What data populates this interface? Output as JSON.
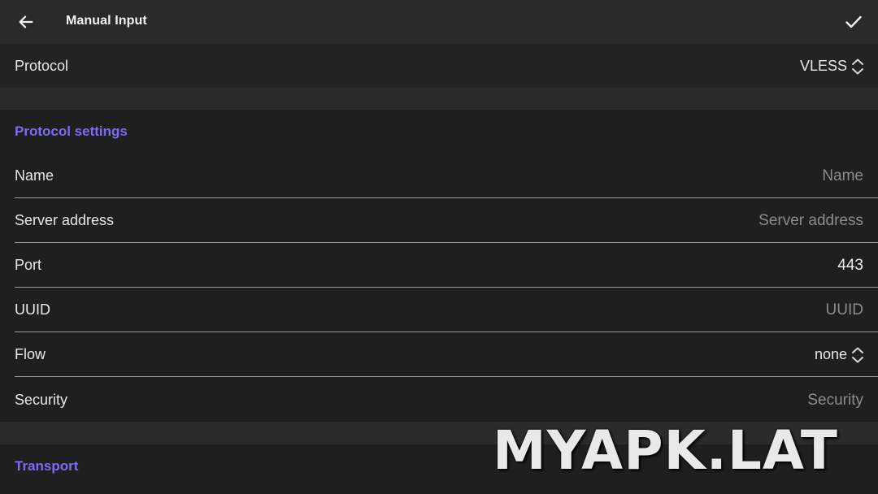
{
  "header": {
    "title": "Manual Input",
    "back_icon": "arrow-left-icon",
    "confirm_icon": "check-icon"
  },
  "protocol": {
    "label": "Protocol",
    "value": "VLESS"
  },
  "sections": {
    "protocol_settings": "Protocol settings",
    "transport": "Transport"
  },
  "fields": {
    "name": {
      "label": "Name",
      "value": "",
      "placeholder": "Name"
    },
    "server_address": {
      "label": "Server address",
      "value": "",
      "placeholder": "Server address"
    },
    "port": {
      "label": "Port",
      "value": "443",
      "placeholder": ""
    },
    "uuid": {
      "label": "UUID",
      "value": "",
      "placeholder": "UUID"
    },
    "flow": {
      "label": "Flow",
      "value": "none"
    },
    "security": {
      "label": "Security",
      "value": "",
      "placeholder": "Security"
    }
  },
  "watermark": "MYAPK.LAT",
  "colors": {
    "accent": "#7b6cf6",
    "background": "#1f1f1f",
    "topbar": "#2a2a2a"
  }
}
